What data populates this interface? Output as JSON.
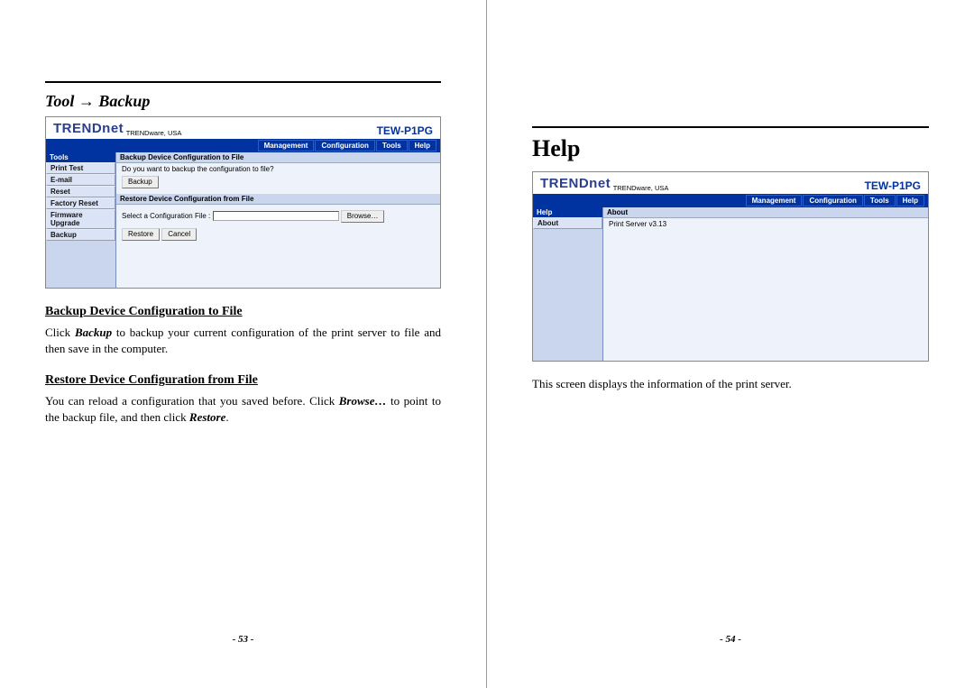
{
  "left": {
    "breadcrumb_title": "Tool → Backup",
    "shot": {
      "brand": "TRENDnet",
      "brand_sub": "TRENDware, USA",
      "model": "TEW-P1PG",
      "nav": {
        "management": "Management",
        "configuration": "Configuration",
        "tools": "Tools",
        "help": "Help"
      },
      "sidebar_header": "Tools",
      "sidebar_items": {
        "print_test": "Print Test",
        "email": "E-mail",
        "reset": "Reset",
        "factory_reset": "Factory Reset",
        "firmware_upgrade": "Firmware Upgrade",
        "backup": "Backup"
      },
      "backup_bar": "Backup Device Configuration to File",
      "backup_q": "Do you want to backup the configuration to file?",
      "backup_btn": "Backup",
      "restore_bar": "Restore Device Configuration from File",
      "select_lbl": "Select a Configuration File :",
      "browse_btn": "Browse…",
      "restore_btn": "Restore",
      "cancel_btn": "Cancel"
    },
    "sub1": "Backup Device Configuration to File",
    "para1a": "Click ",
    "para1b": "Backup",
    "para1c": " to backup your current configuration of the print server to file and then save in the computer.",
    "sub2": "Restore Device Configuration from File",
    "para2a": "You can reload a configuration that you saved before.  Click ",
    "para2b": "Browse…",
    "para2c": " to point to the backup file, and then click ",
    "para2d": "Restore",
    "para2e": ".",
    "page_num": "- 53 -"
  },
  "right": {
    "title": "Help",
    "shot": {
      "brand": "TRENDnet",
      "brand_sub": "TRENDware, USA",
      "model": "TEW-P1PG",
      "nav": {
        "management": "Management",
        "configuration": "Configuration",
        "tools": "Tools",
        "help": "Help"
      },
      "sidebar_header": "Help",
      "sidebar_items": {
        "about": "About"
      },
      "about_bar": "About",
      "about_text": "Print Server v3.13"
    },
    "caption": "This screen displays the information of the print server.",
    "page_num": "- 54 -"
  }
}
